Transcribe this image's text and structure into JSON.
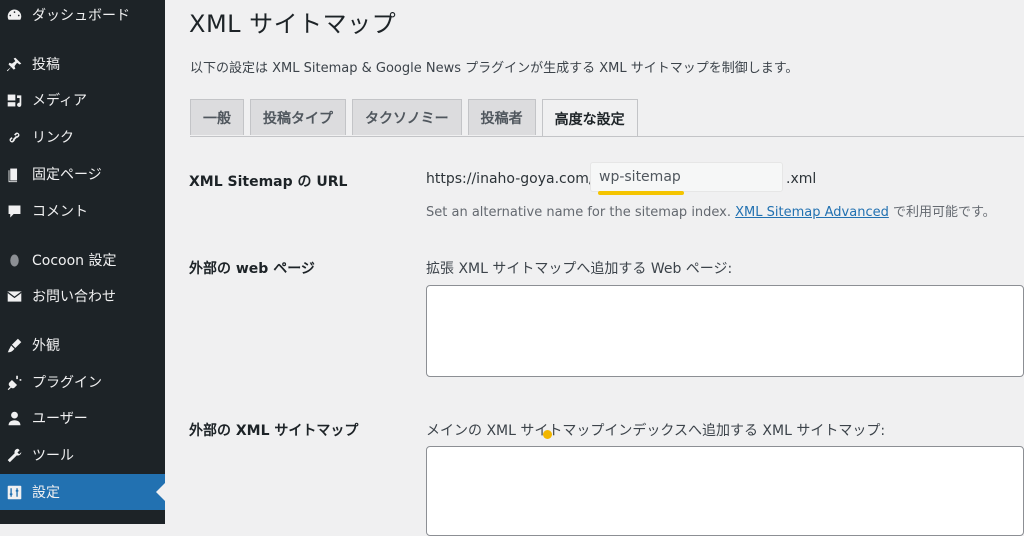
{
  "sidebar": {
    "items": [
      {
        "label": "ダッシュボード",
        "icon": "dashboard-icon"
      },
      {
        "label": "投稿",
        "icon": "pin-icon"
      },
      {
        "label": "メディア",
        "icon": "media-icon"
      },
      {
        "label": "リンク",
        "icon": "link-icon"
      },
      {
        "label": "固定ページ",
        "icon": "page-icon"
      },
      {
        "label": "コメント",
        "icon": "comment-icon"
      },
      {
        "label": "Cocoon 設定",
        "icon": "cocoon-icon"
      },
      {
        "label": "お問い合わせ",
        "icon": "mail-icon"
      },
      {
        "label": "外観",
        "icon": "brush-icon"
      },
      {
        "label": "プラグイン",
        "icon": "plugin-icon"
      },
      {
        "label": "ユーザー",
        "icon": "user-icon"
      },
      {
        "label": "ツール",
        "icon": "wrench-icon"
      },
      {
        "label": "設定",
        "icon": "settings-icon",
        "active": true
      }
    ]
  },
  "page": {
    "title": "XML サイトマップ",
    "description": "以下の設定は XML Sitemap & Google News プラグインが生成する XML サイトマップを制御します。"
  },
  "tabs": [
    {
      "label": "一般"
    },
    {
      "label": "投稿タイプ"
    },
    {
      "label": "タクソノミー"
    },
    {
      "label": "投稿者"
    },
    {
      "label": "高度な設定",
      "active": true
    }
  ],
  "sitemap_url": {
    "label": "XML Sitemap の URL",
    "prefix": "https://inaho-goya.com/",
    "value": "wp-sitemap",
    "suffix": ".xml",
    "hint_text": "Set an alternative name for the sitemap index.",
    "hint_link": "XML Sitemap Advanced",
    "hint_after": "で利用可能です。"
  },
  "external_pages": {
    "label": "外部の web ページ",
    "field_label": "拡張 XML サイトマップへ追加する Web ページ:"
  },
  "external_sitemaps": {
    "label": "外部の XML サイトマップ",
    "field_label": "メインの XML サイトマップインデックスへ追加する XML サイトマップ:"
  },
  "colors": {
    "sidebar_bg": "#1d2327",
    "active_item": "#2271b1",
    "highlight": "#f4c400"
  }
}
